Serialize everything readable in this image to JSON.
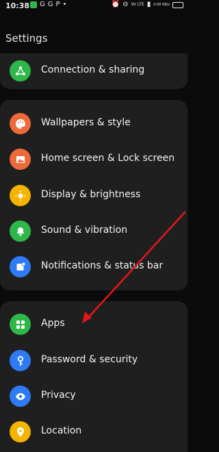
{
  "status": {
    "time": "10:38",
    "left_icons": [
      "green-app-icon",
      "g-icon",
      "g-circle-icon",
      "p-icon",
      "dot-icon"
    ],
    "right_icons": [
      "alarm-icon",
      "do-not-disturb-icon",
      "volte-icon",
      "wifi-signal-icon",
      "cell-signal-icon",
      "battery-icon"
    ],
    "network_label": "Vo LTE",
    "data_label": "0.00 KB/s"
  },
  "page": {
    "title": "Settings"
  },
  "items": [
    {
      "label": "Connection & sharing",
      "icon": "connection-sharing-icon",
      "color": "#2eb84a"
    },
    {
      "label": "Wallpapers & style",
      "icon": "palette-icon",
      "color": "#ef6a3a"
    },
    {
      "label": "Home screen & Lock screen",
      "icon": "image-icon",
      "color": "#ef6a3a"
    },
    {
      "label": "Display & brightness",
      "icon": "sun-icon",
      "color": "#f4b400"
    },
    {
      "label": "Sound & vibration",
      "icon": "bell-icon",
      "color": "#2eb84a"
    },
    {
      "label": "Notifications & status bar",
      "icon": "notification-icon",
      "color": "#2f7bf5"
    },
    {
      "label": "Apps",
      "icon": "apps-grid-icon",
      "color": "#2eb84a"
    },
    {
      "label": "Password & security",
      "icon": "key-icon",
      "color": "#2f7bf5"
    },
    {
      "label": "Privacy",
      "icon": "privacy-eye-icon",
      "color": "#2f7bf5"
    },
    {
      "label": "Location",
      "icon": "location-pin-icon",
      "color": "#f4b400"
    }
  ],
  "annotation": {
    "color": "#e3161b"
  }
}
